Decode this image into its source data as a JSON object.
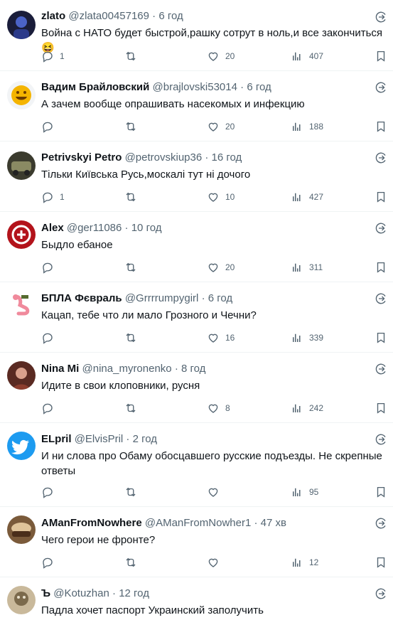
{
  "tweets": [
    {
      "name": "zlato",
      "handle": "@zlata00457169",
      "dot": "·",
      "time": "6 год",
      "text": "Война с НАТО будет быстрой,рашку сотрут в ноль,и все закончиться😆",
      "replies": "1",
      "retweets": "",
      "likes": "20",
      "views": "407",
      "avatar": {
        "bg": "#1a1d3a",
        "fg": "#4b63c8"
      }
    },
    {
      "name": "Вадим Брайловский",
      "handle": "@brajlovski53014",
      "dot": "·",
      "time": "6 год",
      "text": "А зачем вообще опрашивать насекомых и инфекцию",
      "replies": "",
      "retweets": "",
      "likes": "20",
      "views": "188",
      "avatar": {
        "bg": "#f2f4f6",
        "fg": "#f4b400"
      }
    },
    {
      "name": "Petrivskyi Petro",
      "handle": "@petrovskiup36",
      "dot": "·",
      "time": "16 год",
      "text": "Тільки Київська Русь,москалі тут ні дочого",
      "replies": "1",
      "retweets": "",
      "likes": "10",
      "views": "427",
      "avatar": {
        "bg": "#3b3b2e",
        "fg": "#8a8a63"
      }
    },
    {
      "name": "Alex",
      "handle": "@ger11086",
      "dot": "·",
      "time": "10 год",
      "text": "Быдло ебаное",
      "replies": "",
      "retweets": "",
      "likes": "20",
      "views": "311",
      "avatar": {
        "bg": "#b3131b",
        "fg": "#ffffff"
      }
    },
    {
      "name": "БПЛА Фєвраль",
      "handle": "@Grrrrumpygirl",
      "dot": "·",
      "time": "6 год",
      "text": "Кацап, тебе что ли мало Грозного и Чечни?",
      "replies": "",
      "retweets": "",
      "likes": "16",
      "views": "339",
      "avatar": {
        "bg": "#ffffff",
        "fg": "#f08a9c"
      }
    },
    {
      "name": "Nina Mi",
      "handle": "@nina_myronenko",
      "dot": "·",
      "time": "8 год",
      "text": "Идите в свои клоповники, русня",
      "replies": "",
      "retweets": "",
      "likes": "8",
      "views": "242",
      "avatar": {
        "bg": "#5a2a22",
        "fg": "#d9a08c"
      }
    },
    {
      "name": "ELpril",
      "handle": "@ElvisPril",
      "dot": "·",
      "time": "2 год",
      "text": "И ни слова про Обаму обосцавшего русские подъезды. Не скрепные ответы",
      "replies": "",
      "retweets": "",
      "likes": "",
      "views": "95",
      "avatar": {
        "bg": "#1d9bf0",
        "fg": "#ffffff"
      }
    },
    {
      "name": "AManFromNowhere",
      "handle": "@AManFromNowher1",
      "dot": "·",
      "time": "47 хв",
      "text": "Чего герои не фронте?",
      "replies": "",
      "retweets": "",
      "likes": "",
      "views": "12",
      "avatar": {
        "bg": "#7a5a3a",
        "fg": "#e0c49a"
      }
    },
    {
      "name": "Ъ",
      "handle": "@Kotuzhan",
      "dot": "·",
      "time": "12 год",
      "text": "Падла хочет паспорт Украинский заполучить",
      "replies": "",
      "retweets": "",
      "likes": "",
      "views": "",
      "avatar": {
        "bg": "#c9b99b",
        "fg": "#7b6a4c"
      }
    }
  ],
  "colors": {
    "muted": "#536471",
    "divider": "#eff3f4",
    "text": "#0f1419"
  },
  "icons": {
    "reply": "reply-icon",
    "retweet": "retweet-icon",
    "like": "heart-icon",
    "views": "views-icon",
    "bookmark": "bookmark-icon",
    "spam": "spam-flag-icon"
  }
}
